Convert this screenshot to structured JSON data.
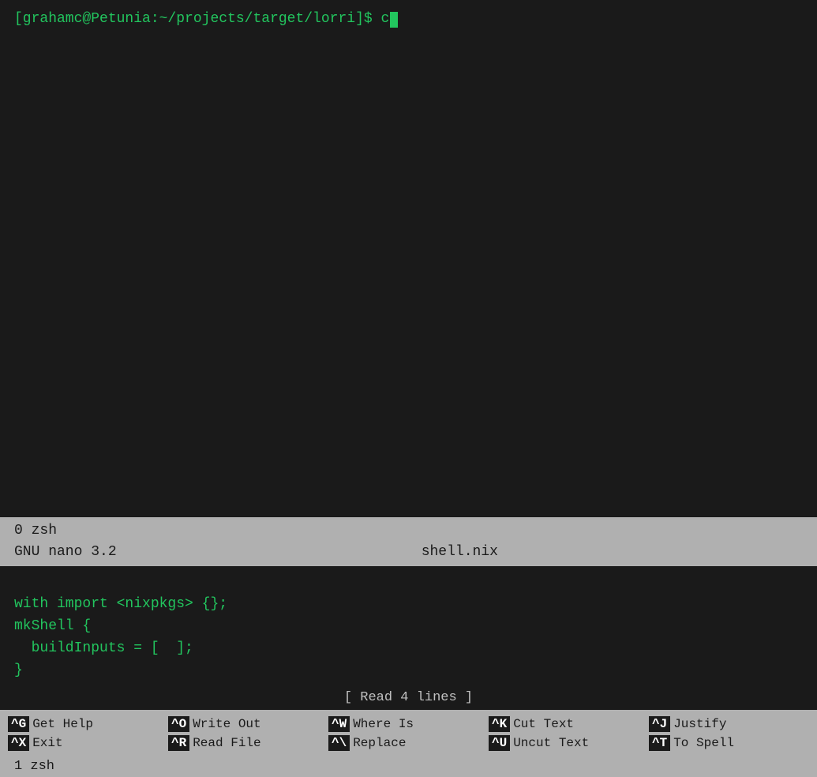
{
  "terminal": {
    "prompt": "[grahamc@Petunia:~/projects/target/lorri]$ c",
    "cursor_char": ""
  },
  "nano": {
    "status_line1": "  0 zsh",
    "status_line2_left": "GNU nano 3.2",
    "status_line2_filename": "shell.nix",
    "editor_lines": [
      "",
      "with import <nixpkgs> {};",
      "mkShell {",
      "  buildInputs = [  ];",
      "}"
    ],
    "read_indicator": "[ Read 4 lines ]",
    "shortcuts": [
      [
        {
          "key": "^G",
          "label": "Get Help"
        },
        {
          "key": "^O",
          "label": "Write Out"
        },
        {
          "key": "^W",
          "label": "Where Is"
        },
        {
          "key": "^K",
          "label": "Cut Text"
        },
        {
          "key": "^J",
          "label": "Justify"
        }
      ],
      [
        {
          "key": "^X",
          "label": "Exit"
        },
        {
          "key": "^R",
          "label": "Read File"
        },
        {
          "key": "^\\",
          "label": "Replace"
        },
        {
          "key": "^U",
          "label": "Uncut Text"
        },
        {
          "key": "^T",
          "label": "To Spell"
        }
      ]
    ],
    "bottom_bar": "  1 zsh"
  }
}
